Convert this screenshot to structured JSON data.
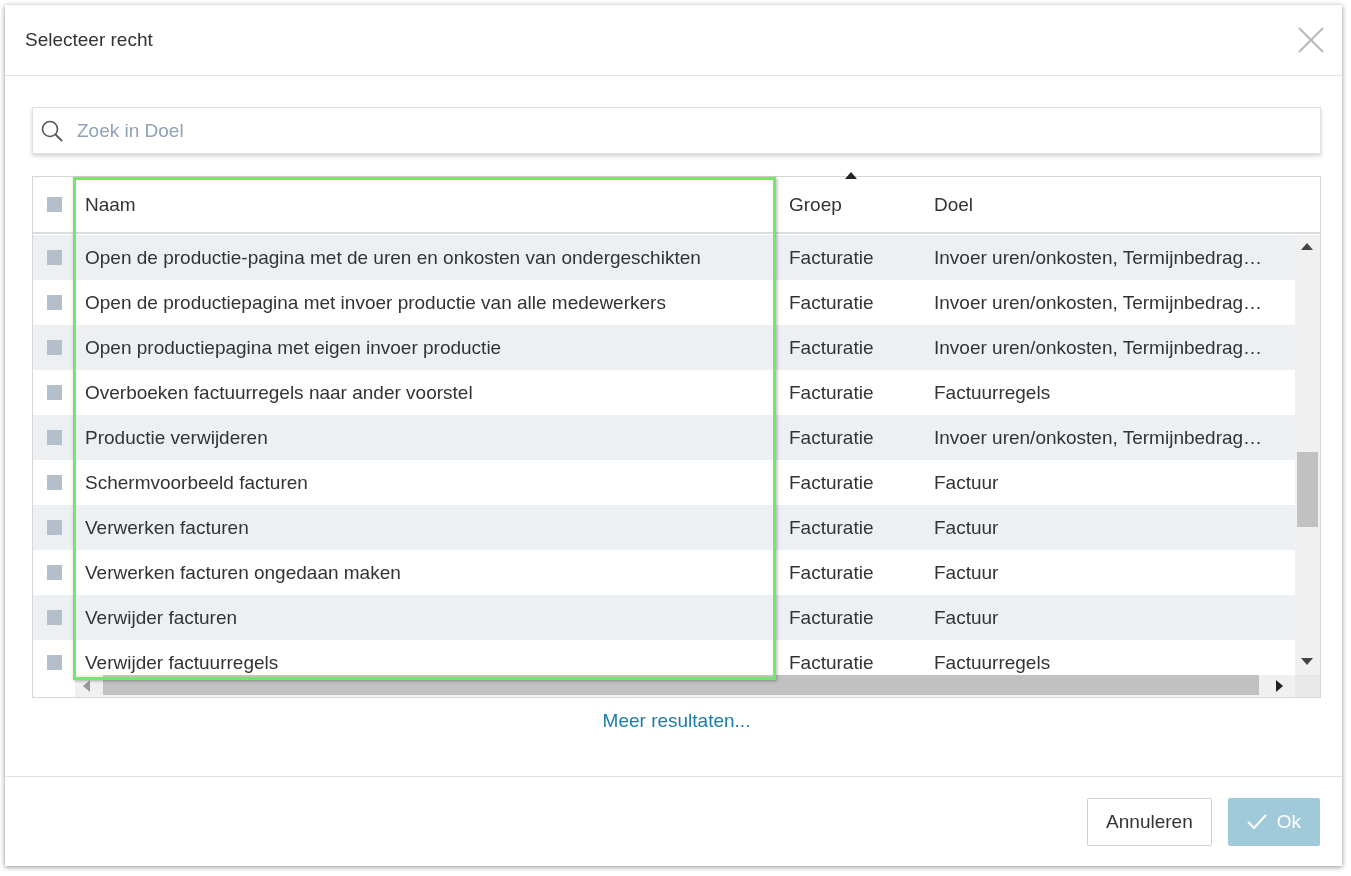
{
  "dialog": {
    "title": "Selecteer recht"
  },
  "search": {
    "placeholder": "Zoek in Doel"
  },
  "table": {
    "header_checkbox": {
      "checked": false
    },
    "columns": [
      {
        "label": "Naam",
        "sorted_ascending": false,
        "highlighted": true
      },
      {
        "label": "Groep",
        "sorted_ascending": true,
        "highlighted": false
      },
      {
        "label": "Doel",
        "sorted_ascending": false,
        "highlighted": false
      }
    ],
    "rows": [
      {
        "checked": false,
        "cells": [
          "Open de productie-pagina met de uren en onkosten van ondergeschikten",
          "Facturatie",
          "Invoer uren/onkosten, Termijnbedrag…"
        ]
      },
      {
        "checked": false,
        "cells": [
          "Open de productiepagina met invoer productie van alle medewerkers",
          "Facturatie",
          "Invoer uren/onkosten, Termijnbedrag…"
        ]
      },
      {
        "checked": false,
        "cells": [
          "Open productiepagina met eigen invoer productie",
          "Facturatie",
          "Invoer uren/onkosten, Termijnbedrag…"
        ]
      },
      {
        "checked": false,
        "cells": [
          "Overboeken factuurregels naar ander voorstel",
          "Facturatie",
          "Factuurregels"
        ]
      },
      {
        "checked": false,
        "cells": [
          "Productie verwijderen",
          "Facturatie",
          "Invoer uren/onkosten, Termijnbedrag…"
        ]
      },
      {
        "checked": false,
        "cells": [
          "Schermvoorbeeld facturen",
          "Facturatie",
          "Factuur"
        ]
      },
      {
        "checked": false,
        "cells": [
          "Verwerken facturen",
          "Facturatie",
          "Factuur"
        ]
      },
      {
        "checked": false,
        "cells": [
          "Verwerken facturen ongedaan maken",
          "Facturatie",
          "Factuur"
        ]
      },
      {
        "checked": false,
        "cells": [
          "Verwijder facturen",
          "Facturatie",
          "Factuur"
        ]
      },
      {
        "checked": false,
        "cells": [
          "Verwijder factuurregels",
          "Facturatie",
          "Factuurregels"
        ]
      }
    ]
  },
  "more_link": "Meer resultaten...",
  "buttons": [
    {
      "kind": "secondary",
      "label": "Annuleren",
      "disabled": false
    },
    {
      "kind": "primary",
      "label": "Ok",
      "disabled": true
    }
  ]
}
